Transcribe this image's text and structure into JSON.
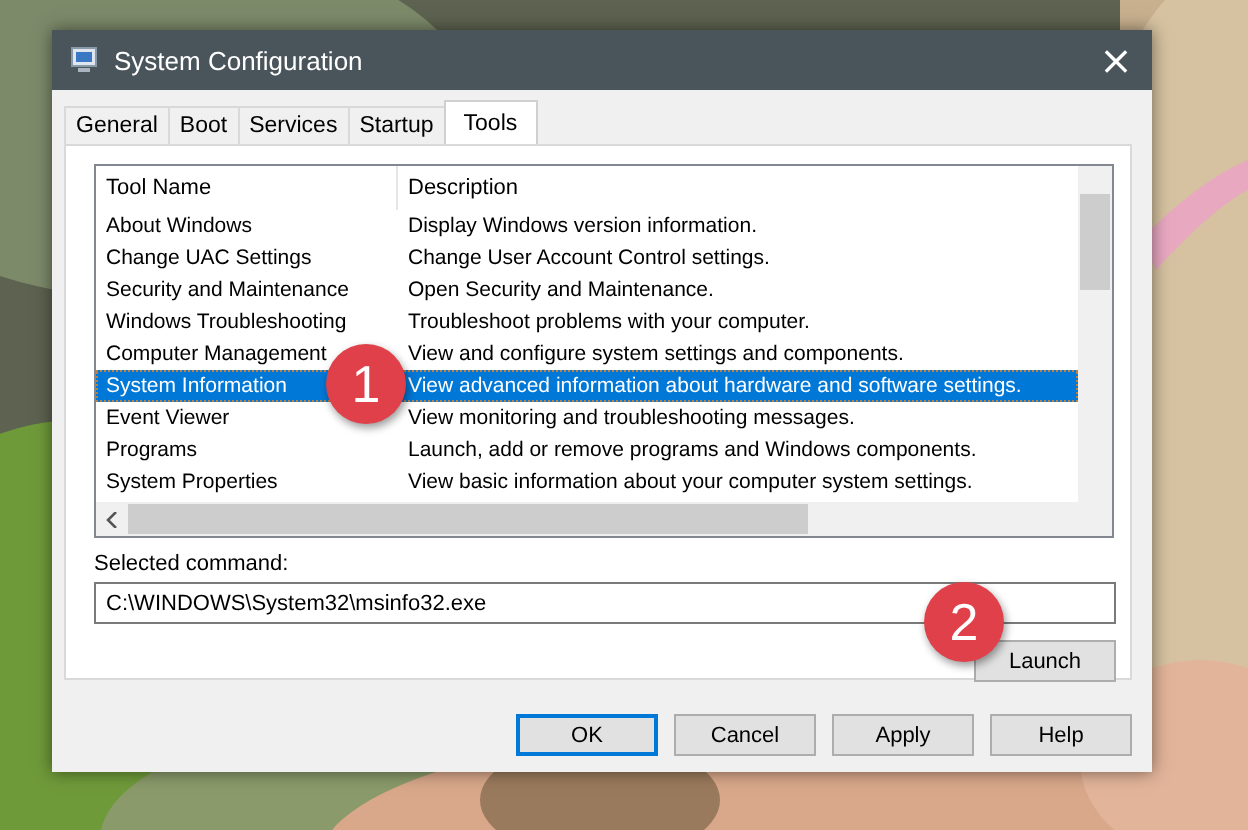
{
  "window": {
    "title": "System Configuration",
    "close": "×"
  },
  "tabs": [
    {
      "label": "General",
      "selected": false
    },
    {
      "label": "Boot",
      "selected": false
    },
    {
      "label": "Services",
      "selected": false
    },
    {
      "label": "Startup",
      "selected": false
    },
    {
      "label": "Tools",
      "selected": true
    }
  ],
  "table": {
    "columns": [
      "Tool Name",
      "Description"
    ],
    "rows": [
      {
        "name": "About Windows",
        "description": "Display Windows version information.",
        "selected": false
      },
      {
        "name": "Change UAC Settings",
        "description": "Change User Account Control settings.",
        "selected": false
      },
      {
        "name": "Security and Maintenance",
        "description": "Open Security and Maintenance.",
        "selected": false
      },
      {
        "name": "Windows Troubleshooting",
        "description": "Troubleshoot problems with your computer.",
        "selected": false
      },
      {
        "name": "Computer Management",
        "description": "View and configure system settings and components.",
        "selected": false
      },
      {
        "name": "System Information",
        "description": "View advanced information about hardware and software settings.",
        "selected": true
      },
      {
        "name": "Event Viewer",
        "description": "View monitoring and troubleshooting messages.",
        "selected": false
      },
      {
        "name": "Programs",
        "description": "Launch, add or remove programs and Windows components.",
        "selected": false
      },
      {
        "name": "System Properties",
        "description": "View basic information about your computer system settings.",
        "selected": false
      }
    ]
  },
  "selected_command": {
    "label": "Selected command:",
    "value": "C:\\WINDOWS\\System32\\msinfo32.exe"
  },
  "launch_button": "Launch",
  "buttons": [
    {
      "label": "OK",
      "default": true
    },
    {
      "label": "Cancel",
      "default": false
    },
    {
      "label": "Apply",
      "default": false
    },
    {
      "label": "Help",
      "default": false
    }
  ],
  "annotations": [
    {
      "label": "1"
    },
    {
      "label": "2"
    }
  ]
}
